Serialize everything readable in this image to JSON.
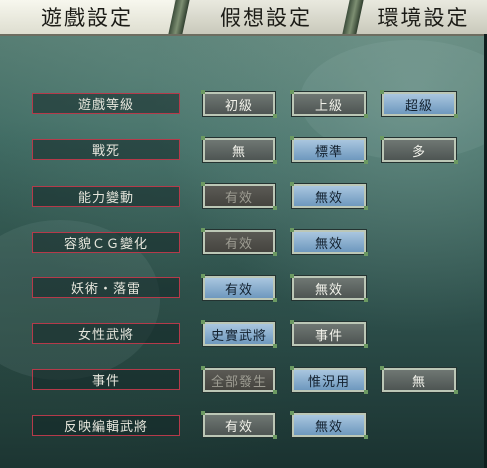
{
  "tabs": [
    {
      "label": "遊戲設定",
      "active": true
    },
    {
      "label": "假想設定",
      "active": false
    },
    {
      "label": "環境設定",
      "active": false
    }
  ],
  "rows": [
    {
      "label": "遊戲等級",
      "options": [
        {
          "text": "初級",
          "state": "off"
        },
        {
          "text": "上級",
          "state": "off"
        },
        {
          "text": "超級",
          "state": "on"
        }
      ]
    },
    {
      "label": "戰死",
      "options": [
        {
          "text": "無",
          "state": "off"
        },
        {
          "text": "標準",
          "state": "on"
        },
        {
          "text": "多",
          "state": "off"
        }
      ]
    },
    {
      "label": "能力變動",
      "options": [
        {
          "text": "有效",
          "state": "disabled"
        },
        {
          "text": "無效",
          "state": "on"
        }
      ]
    },
    {
      "label": "容貌ＣＧ變化",
      "options": [
        {
          "text": "有效",
          "state": "disabled"
        },
        {
          "text": "無效",
          "state": "on"
        }
      ]
    },
    {
      "label": "妖術・落雷",
      "options": [
        {
          "text": "有效",
          "state": "on"
        },
        {
          "text": "無效",
          "state": "off"
        }
      ]
    },
    {
      "label": "女性武將",
      "options": [
        {
          "text": "史實武將",
          "state": "on"
        },
        {
          "text": "事件",
          "state": "off"
        }
      ]
    },
    {
      "label": "事件",
      "options": [
        {
          "text": "全部發生",
          "state": "disabled"
        },
        {
          "text": "惟況用",
          "state": "on"
        },
        {
          "text": "無",
          "state": "off"
        }
      ]
    },
    {
      "label": "反映編輯武將",
      "options": [
        {
          "text": "有效",
          "state": "off"
        },
        {
          "text": "無效",
          "state": "on"
        }
      ]
    }
  ],
  "colors": {
    "selected": "#8fb2d3",
    "unselected": "#5f6764",
    "disabled": "#504f4a",
    "label_border": "#b53a4a"
  }
}
